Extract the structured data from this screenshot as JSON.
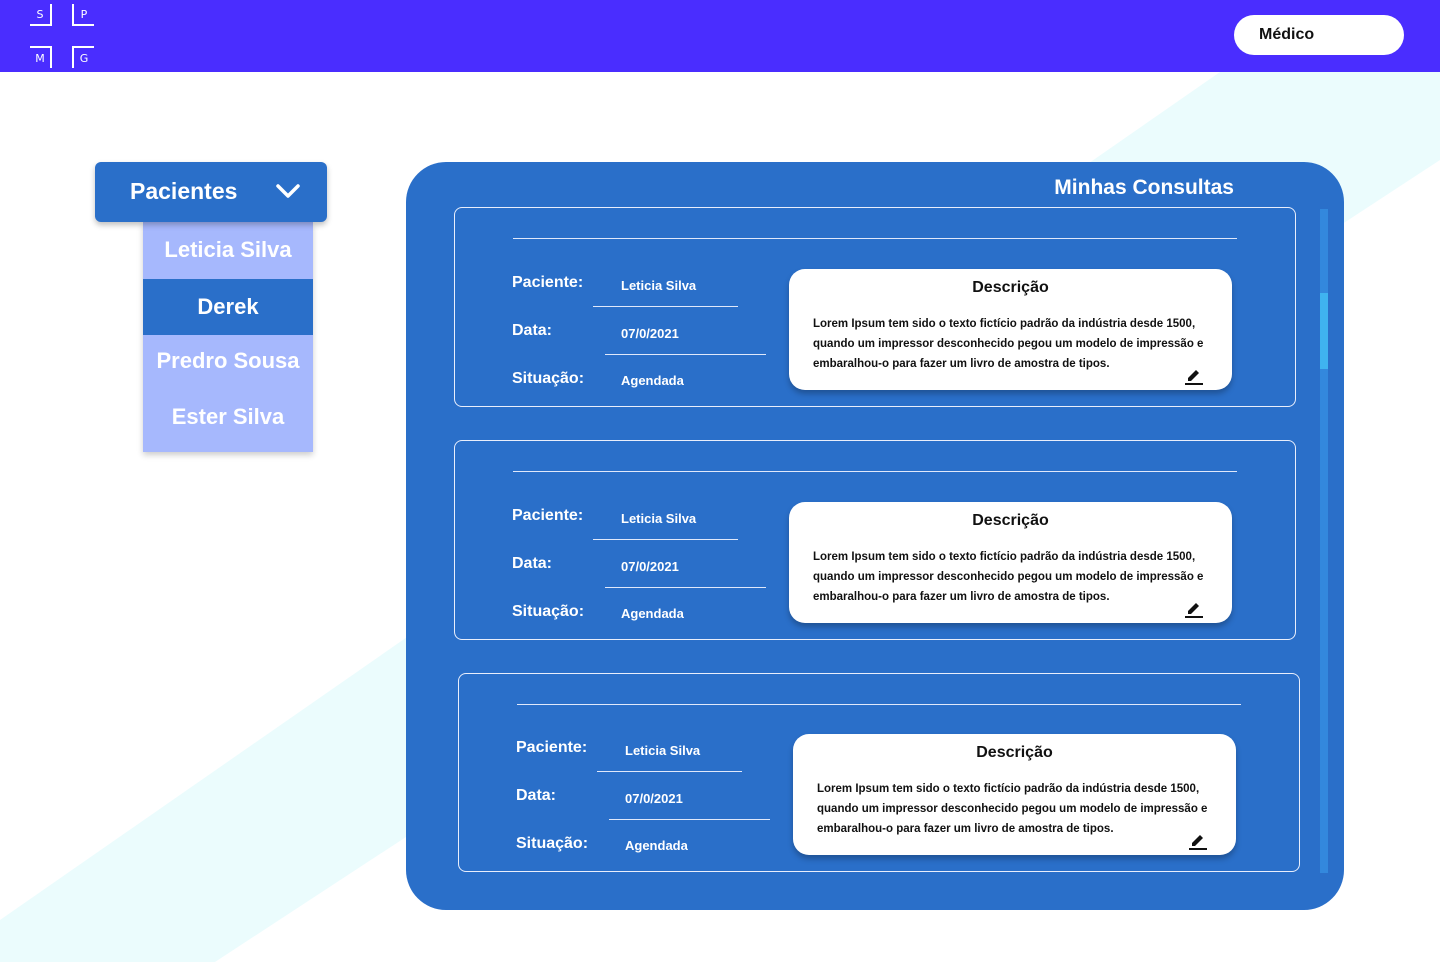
{
  "topbar": {
    "logo": {
      "s": "S",
      "p": "P",
      "m": "M",
      "g": "G"
    },
    "role_button": "Médico",
    "color": "#4a2dff"
  },
  "sidebar": {
    "dropdown_label": "Pacientes",
    "dropdown_icon": "chevron-down-icon",
    "patients": [
      {
        "name": "Leticia Silva",
        "active": false
      },
      {
        "name": "Derek",
        "active": true
      },
      {
        "name": "Predro Sousa",
        "active": false
      },
      {
        "name": "Ester Silva",
        "active": false
      }
    ]
  },
  "panel": {
    "title": "Minhas Consultas",
    "color": "#2a6fc9",
    "consultas": [
      {
        "paciente_label": "Paciente:",
        "paciente": "Leticia Silva",
        "data_label": "Data:",
        "data": "07/0/2021",
        "situacao_label": "Situação:",
        "situacao": "Agendada",
        "descricao_title": "Descrição",
        "descricao": "Lorem Ipsum tem sido o texto fictício padrão da indústria desde 1500, quando um impressor desconhecido pegou um modelo de impressão e embaralhou-o para fazer um livro de amostra de tipos.",
        "edit_icon": "pencil-icon"
      },
      {
        "paciente_label": "Paciente:",
        "paciente": "Leticia Silva",
        "data_label": "Data:",
        "data": "07/0/2021",
        "situacao_label": "Situação:",
        "situacao": "Agendada",
        "descricao_title": "Descrição",
        "descricao": "Lorem Ipsum tem sido o texto fictício padrão da indústria desde 1500, quando um impressor desconhecido pegou um modelo de impressão e embaralhou-o para fazer um livro de amostra de tipos.",
        "edit_icon": "pencil-icon"
      },
      {
        "paciente_label": "Paciente:",
        "paciente": "Leticia Silva",
        "data_label": "Data:",
        "data": "07/0/2021",
        "situacao_label": "Situação:",
        "situacao": "Agendada",
        "descricao_title": "Descrição",
        "descricao": "Lorem Ipsum tem sido o texto fictício padrão da indústria desde 1500, quando um impressor desconhecido pegou um modelo de impressão e embaralhou-o para fazer um livro de amostra de tipos.",
        "edit_icon": "pencil-icon"
      }
    ]
  }
}
